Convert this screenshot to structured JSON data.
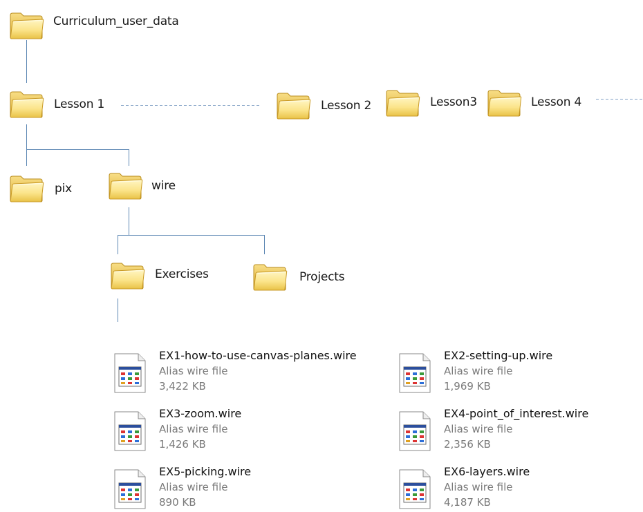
{
  "folders": {
    "root": "Curriculum_user_data",
    "lesson1": "Lesson 1",
    "lesson2": "Lesson 2",
    "lesson3": "Lesson3",
    "lesson4": "Lesson 4",
    "pix": "pix",
    "wire": "wire",
    "exercises": "Exercises",
    "projects": "Projects"
  },
  "files": [
    {
      "name": "EX1-how-to-use-canvas-planes.wire",
      "type": "Alias wire file",
      "size": "3,422 KB"
    },
    {
      "name": "EX2-setting-up.wire",
      "type": "Alias wire file",
      "size": "1,969 KB"
    },
    {
      "name": "EX3-zoom.wire",
      "type": "Alias wire file",
      "size": "1,426 KB"
    },
    {
      "name": "EX4-point_of_interest.wire",
      "type": "Alias wire file",
      "size": "2,356 KB"
    },
    {
      "name": "EX5-picking.wire",
      "type": "Alias wire file",
      "size": "890 KB"
    },
    {
      "name": "EX6-layers.wire",
      "type": "Alias wire file",
      "size": "4,187 KB"
    }
  ],
  "icons": {
    "folder": "folder-icon",
    "file": "wire-file-icon"
  },
  "colors": {
    "connector": "#5b86b3",
    "folder_light": "#fff3b0",
    "folder_dark": "#e7bd3e",
    "meta_text": "#7a7a7a"
  }
}
